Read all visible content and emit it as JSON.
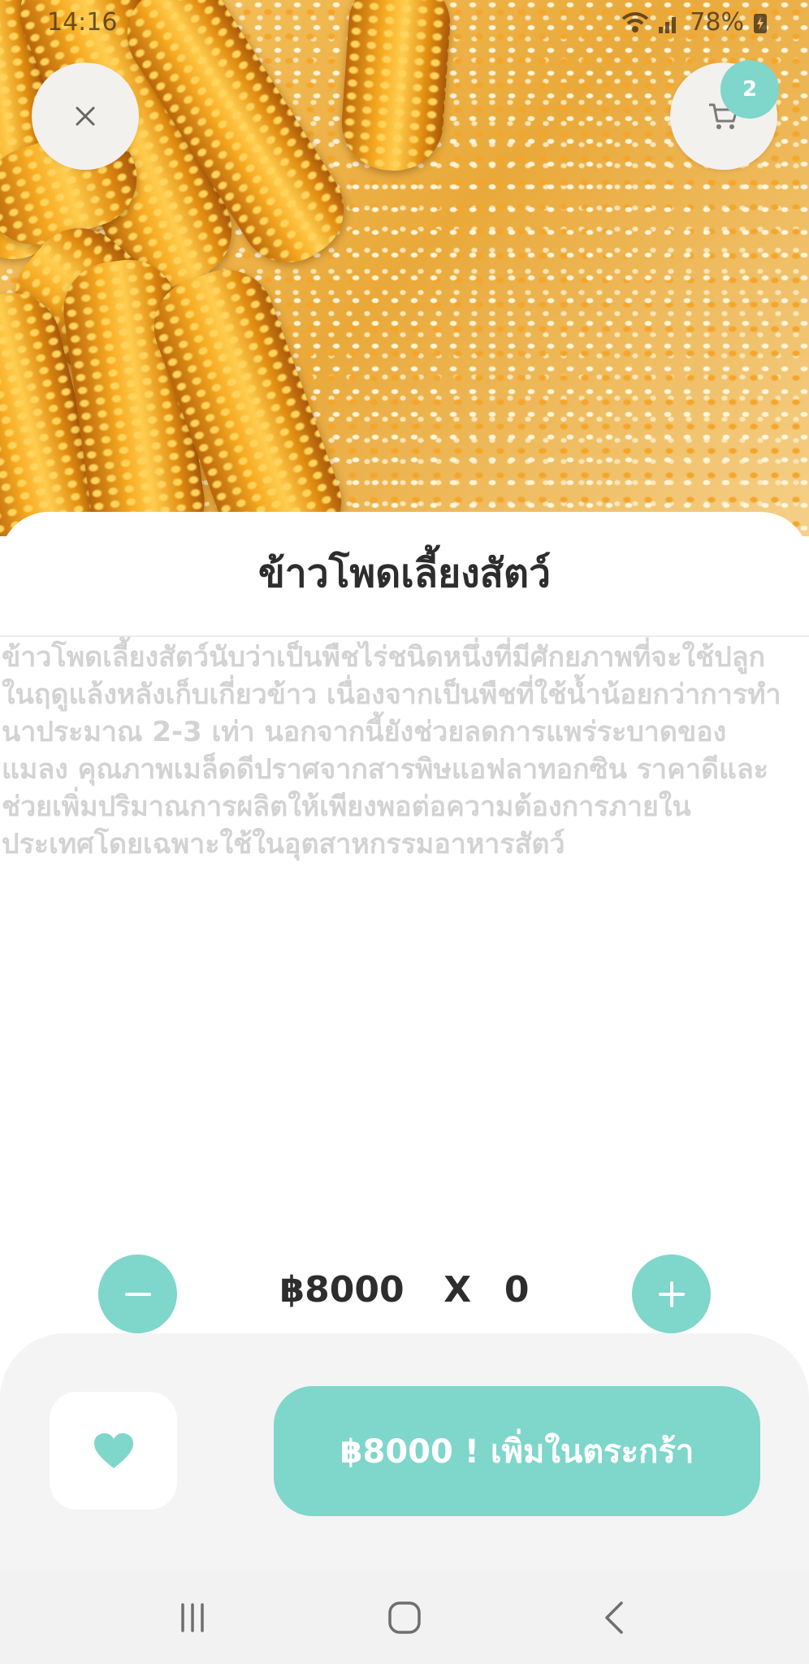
{
  "status_bar": {
    "time": "14:16",
    "battery": "78%"
  },
  "header": {
    "cart_count": "2"
  },
  "product": {
    "title": "ข้าวโพดเลี้ยงสัตว์",
    "description": "ข้าวโพดเลี้ยงสัตว์นับว่าเป็นพืชไร่ชนิดหนึ่งที่มีศักยภาพที่จะใช้ปลูกในฤดูแล้งหลังเก็บเกี่ยวข้าว เนื่องจากเป็นพืชที่ใช้น้ำน้อยกว่าการทำนาประมาณ 2-3 เท่า นอกจากนี้ยังช่วยลดการแพร่ระบาดของแมลง คุณภาพเมล็ดดีปราศจากสารพิษแอฟลาทอกซิน ราคาดีและช่วยเพิ่มปริมาณการผลิตให้เพียงพอต่อความต้องการภายในประเทศโดยเฉพาะใช้ในอุตสาหกรรมอาหารสัตว์"
  },
  "quantity": {
    "price": "฿8000",
    "multiplier": "X",
    "count": "0"
  },
  "actions": {
    "add_to_cart_label": "฿8000 ! เพิ่มในตระกร้า"
  },
  "icons": {
    "close": "close-icon",
    "cart": "cart-icon",
    "minus": "minus-icon",
    "plus": "plus-icon",
    "favorite": "heart-icon",
    "nav_recents": "recents-icon",
    "nav_home": "home-icon",
    "nav_back": "back-icon"
  },
  "colors": {
    "accent": "#7fd6cb",
    "title_text": "#2d2d2d",
    "description_text": "#d3d3d3",
    "panel_bg": "#f4f4f4"
  }
}
